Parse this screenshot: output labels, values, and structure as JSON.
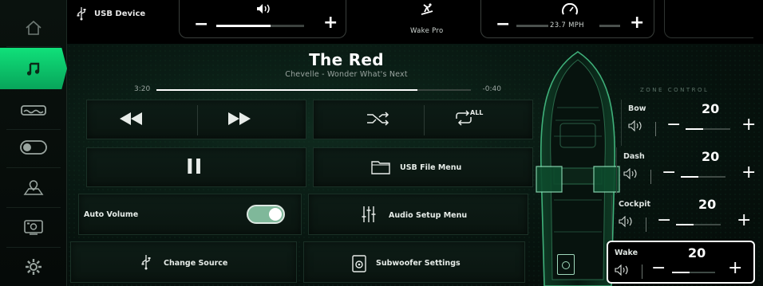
{
  "rail": {
    "items": [
      {
        "icon": "home-icon"
      },
      {
        "icon": "music-note-icon",
        "active": true
      },
      {
        "icon": "boat-wave-icon"
      },
      {
        "icon": "toggle-switch-icon"
      },
      {
        "icon": "map-pin-icon"
      },
      {
        "icon": "camera-icon"
      },
      {
        "icon": "gear-icon"
      }
    ]
  },
  "topbar": {
    "source_label": "USB Device",
    "volume": {
      "minus": "−",
      "plus": "+",
      "level": 0.62
    },
    "mode_label": "Wake Pro",
    "speed": {
      "minus": "−",
      "plus": "+",
      "value": "23.7 MPH"
    }
  },
  "now_playing": {
    "title": "The Red",
    "subtitle": "Chevelle - Wonder What's Next",
    "elapsed": "3:20",
    "remaining": "-0:40",
    "progress": 0.83
  },
  "controls": {
    "pause_symbol": "II",
    "usb_file_menu": "USB File Menu",
    "auto_volume": "Auto Volume",
    "auto_volume_on": true,
    "audio_setup_menu": "Audio Setup Menu",
    "change_source": "Change Source",
    "subwoofer_settings": "Subwoofer Settings",
    "repeat_label": "ALL"
  },
  "zones": {
    "title": "ZONE CONTROL",
    "items": [
      {
        "name": "Bow",
        "value": "20",
        "level": 0.4
      },
      {
        "name": "Dash",
        "value": "20",
        "level": 0.4
      },
      {
        "name": "Cockpit",
        "value": "20",
        "level": 0.4
      },
      {
        "name": "Wake",
        "value": "20",
        "level": 0.4,
        "active": true
      }
    ]
  },
  "colors": {
    "accent": "#10e07a",
    "background": "#07140f"
  }
}
